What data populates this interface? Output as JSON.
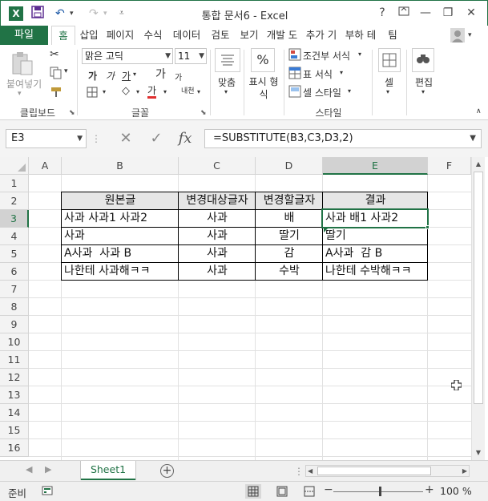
{
  "window": {
    "title": "통합 문서6 - Excel",
    "app_icon": "X",
    "help": "?",
    "minimize": "—",
    "restore": "❐",
    "close": "✕",
    "signin_arrow": "▾"
  },
  "ribbon_tabs": {
    "file": "파일",
    "tabs": [
      "홈",
      "삽입",
      "페이지",
      "수식",
      "데이터",
      "검토",
      "보기",
      "개발 도",
      "추가 기",
      "부하 테",
      "팀"
    ]
  },
  "clipboard": {
    "paste": "붙여넣기",
    "label": "클립보드"
  },
  "font": {
    "name": "맑은 고딕",
    "size": "11",
    "bold": "가",
    "italic": "가",
    "underline": "가",
    "grow": "가",
    "shrink": "가",
    "font_color": "가",
    "phonetic": "내천",
    "label": "글꼴"
  },
  "alignment": {
    "label": "맞춤"
  },
  "number": {
    "symbol": "%",
    "label": "표시 형식"
  },
  "styles": {
    "conditional": "조건부 서식",
    "table": "표 서식",
    "cell_styles": "셀 스타일",
    "label": "스타일"
  },
  "cells": {
    "label": "셀"
  },
  "editing": {
    "label": "편집"
  },
  "formula_bar": {
    "name_box": "E3",
    "cancel": "✕",
    "enter": "✓",
    "fx": "fx",
    "formula": "=SUBSTITUTE(B3,C3,D3,2)"
  },
  "columns": [
    "A",
    "B",
    "C",
    "D",
    "E",
    "F"
  ],
  "rows": [
    "1",
    "2",
    "3",
    "4",
    "5",
    "6",
    "7",
    "8",
    "9",
    "10",
    "11",
    "12",
    "13",
    "14",
    "15",
    "16"
  ],
  "table": {
    "headers": [
      "원본글",
      "변경대상글자",
      "변경할글자",
      "결과"
    ],
    "rows": [
      [
        "사과 사과1 사과2",
        "사과",
        "배",
        "사과 배1 사과2"
      ],
      [
        "사과",
        "사과",
        "딸기",
        "딸기"
      ],
      [
        "A사과  사과 B",
        "사과",
        "감",
        "A사과  감 B"
      ],
      [
        "나한테 사과해ㅋㅋ",
        "사과",
        "수박",
        "나한테 수박해ㅋㅋ"
      ]
    ]
  },
  "sheets": {
    "active": "Sheet1",
    "add": "+"
  },
  "status": {
    "ready": "준비",
    "zoom": "100 %",
    "zoom_minus": "−",
    "zoom_plus": "+"
  }
}
